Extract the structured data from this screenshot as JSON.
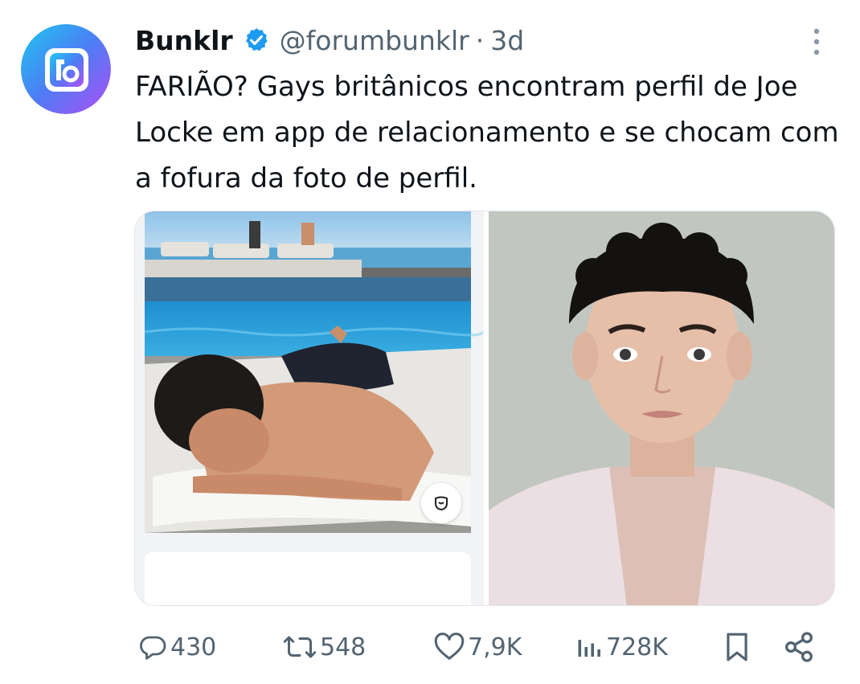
{
  "tweet": {
    "display_name": "Bunklr",
    "handle": "@forumbunklr",
    "separator": "·",
    "time": "3d",
    "text": "FARIÃO? Gays britânicos encontram perfil de Joe Locke em app de relacionamento e se chocam com a fofura da foto de perfil."
  },
  "icons": {
    "avatar": "bunklr-logo",
    "verified": "verified-badge-icon",
    "more": "more-vertical-icon",
    "reply": "reply-icon",
    "retweet": "retweet-icon",
    "like": "heart-icon",
    "views": "views-icon",
    "bookmark": "bookmark-icon",
    "share": "share-icon"
  },
  "actions": {
    "replies": "430",
    "retweets": "548",
    "likes": "7,9K",
    "views": "728K"
  },
  "colors": {
    "verified": "#1d9bf0",
    "secondary_text": "#536471",
    "primary_text": "#0f1419"
  }
}
